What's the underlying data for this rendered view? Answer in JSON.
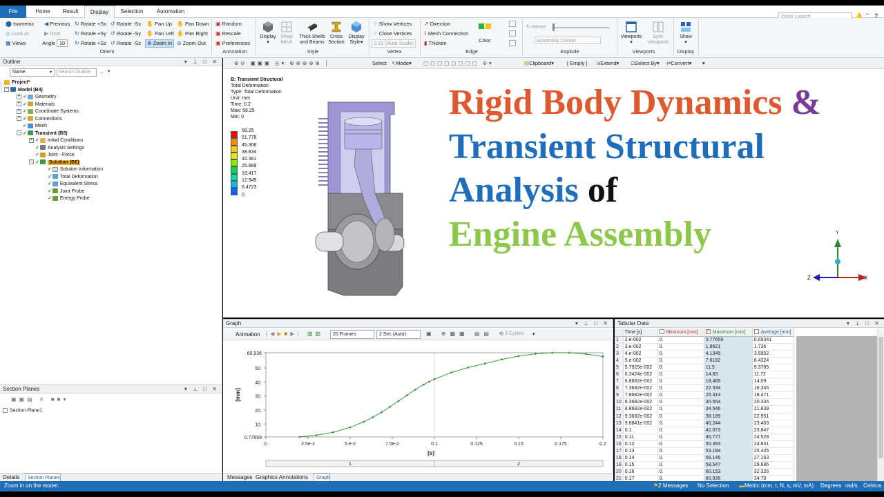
{
  "tabs": [
    "File",
    "Home",
    "Result",
    "Display",
    "Selection",
    "Automation"
  ],
  "quick_launch": "Quick Launch",
  "ribbon": {
    "orient": {
      "isometric": "Isometric",
      "previous": "Previous",
      "look_at": "Look At",
      "next": "Next",
      "views": "Views",
      "angle_label": "Angle",
      "angle_value": "10",
      "rotate_px": "Rotate +Sx",
      "rotate_nx": "Rotate -Sx",
      "rotate_py": "Rotate +Sy",
      "rotate_ny": "Rotate -Sy",
      "rotate_pz": "Rotate +Sz",
      "rotate_nz": "Rotate -Sz",
      "pan_up": "Pan Up",
      "pan_down": "Pan Down",
      "pan_left": "Pan Left",
      "pan_right": "Pan Right",
      "zoom_in": "Zoom In",
      "zoom_out": "Zoom Out",
      "group": "Orient"
    },
    "annotation": {
      "random": "Random",
      "rescale": "Rescale",
      "preferences": "Preferences",
      "group": "Annotation"
    },
    "style": {
      "display": "Display",
      "show_mesh": "Show Mesh",
      "thick_shells": "Thick Shells and Beams",
      "cross_section": "Cross Section",
      "display_style": "Display Style",
      "group": "Style"
    },
    "vertex": {
      "show_vertices": "Show Vertices",
      "close_vertices": "Close Vertices",
      "auto_scale": "0.31 (Auto Scale)",
      "group": "Vertex"
    },
    "edge": {
      "direction": "Direction",
      "mesh_connection": "Mesh Connection",
      "thicken": "Thicken",
      "color": "Color",
      "group": "Edge"
    },
    "explode": {
      "reset": "Reset",
      "assembly_center": "Assembly Center",
      "group": "Explode"
    },
    "viewports": {
      "viewports": "Viewports",
      "sync": "Sync Viewports",
      "group": "Viewports"
    },
    "display": {
      "show": "Show",
      "group": "Display"
    }
  },
  "outline": {
    "title": "Outline",
    "name_filter": "Name",
    "search_placeholder": "Search Outline",
    "items": [
      {
        "label": "Project*",
        "level": 0
      },
      {
        "label": "Model (B4)",
        "level": 1
      },
      {
        "label": "Geometry",
        "level": 2
      },
      {
        "label": "Materials",
        "level": 2
      },
      {
        "label": "Coordinate Systems",
        "level": 2
      },
      {
        "label": "Connections",
        "level": 2
      },
      {
        "label": "Mesh",
        "level": 2
      },
      {
        "label": "Transient (B5)",
        "level": 2
      },
      {
        "label": "Initial Conditions",
        "level": 3
      },
      {
        "label": "Analysis Settings",
        "level": 3
      },
      {
        "label": "Joint - Force",
        "level": 3
      },
      {
        "label": "Solution (B6)",
        "level": 3
      },
      {
        "label": "Solution Information",
        "level": 4
      },
      {
        "label": "Total Deformation",
        "level": 4
      },
      {
        "label": "Equivalent Stress",
        "level": 4
      },
      {
        "label": "Joint Probe",
        "level": 4
      },
      {
        "label": "Energy Probe",
        "level": 4
      }
    ]
  },
  "section_planes": {
    "title": "Section Planes",
    "item": "Section Plane1"
  },
  "left_tabs": [
    "Details",
    "Section Planes"
  ],
  "viewport_toolbar": {
    "select": "Select",
    "mode": "Mode",
    "clipboard": "Clipboard",
    "empty": "[ Empty ]",
    "extend": "Extend",
    "select_by": "Select By",
    "convert": "Convert"
  },
  "result_info": {
    "title": "B: Transient Structural",
    "lines": [
      "Total Deformation",
      "Type: Total Deformation",
      "Unit: mm",
      "Time: 0.2",
      "Max: 58.25",
      "Min: 0"
    ]
  },
  "legend": {
    "values": [
      "58.25",
      "51.778",
      "45.306",
      "38.834",
      "32.361",
      "25.889",
      "19.417",
      "12.945",
      "6.4723",
      "0"
    ],
    "colors": [
      "#ff0000",
      "#ff8800",
      "#ffcc00",
      "#ddee00",
      "#88ee00",
      "#00dd44",
      "#00ddaa",
      "#00bbee",
      "#0066ff",
      "#0000ff"
    ]
  },
  "headline": {
    "line1_a": "Rigid Body Dynamics",
    "line1_b": "&",
    "line2": "Transient Structural",
    "line3_a": "Analysis",
    "line3_b": "of",
    "line4": "Engine Assembly",
    "colors": {
      "orange": "#e0582e",
      "purple": "#7a3c9c",
      "blue": "#1f6ebd",
      "black": "#111111",
      "green": "#8ec84a"
    }
  },
  "triad": {
    "x": "X",
    "y": "Y",
    "z": "Z"
  },
  "graph": {
    "title": "Graph",
    "animation": "Animation",
    "frames": "20 Frames",
    "duration": "2 Sec (Auto)",
    "cycles": "3 Cycles",
    "steps": [
      "1",
      "2"
    ]
  },
  "chart_data": {
    "type": "line",
    "ylabel": "[mm]",
    "xlabel": "[s]",
    "x": [
      0.02,
      0.03,
      0.04,
      0.05,
      0.057925,
      0.063424,
      0.068682,
      0.073682,
      0.078682,
      0.083682,
      0.088682,
      0.093682,
      0.096841,
      0.1,
      0.11,
      0.12,
      0.13,
      0.14,
      0.15,
      0.16,
      0.17,
      0.18,
      0.19,
      0.2
    ],
    "values": [
      0.77659,
      1.9621,
      4.1349,
      7.6182,
      11.5,
      14.83,
      18.489,
      22.334,
      26.414,
      30.554,
      34.546,
      38.189,
      40.244,
      42.073,
      46.777,
      50.393,
      53.194,
      56.146,
      58.547,
      60.153,
      60.936,
      60.9,
      60.0,
      58.25
    ],
    "xlim": [
      0,
      0.2
    ],
    "ylim": [
      0.77659,
      60.936
    ],
    "yticks": [
      "60.936",
      "50.",
      "40.",
      "30.",
      "20.",
      "10.",
      "0.77659"
    ],
    "xticks": [
      "0.",
      "2.5e-2",
      "5.e-2",
      "7.5e-2",
      "0.1",
      "0.125",
      "0.15",
      "0.175",
      "0.2"
    ],
    "color": "#2a8a2a"
  },
  "tabular": {
    "title": "Tabular Data",
    "headers": [
      "",
      "Time [s]",
      "Minimum [mm]",
      "Maximum [mm]",
      "Average [mm]"
    ],
    "rows": [
      [
        "1",
        "2.e-002",
        "0.",
        "0.77659",
        "0.69341"
      ],
      [
        "2",
        "3.e-002",
        "0.",
        "1.9621",
        "1.736"
      ],
      [
        "3",
        "4.e-002",
        "0.",
        "4.1349",
        "3.5952"
      ],
      [
        "4",
        "5.e-002",
        "0.",
        "7.6182",
        "6.4324"
      ],
      [
        "5",
        "5.7925e-002",
        "0.",
        "11.5",
        "9.3785"
      ],
      [
        "6",
        "6.3424e-002",
        "0.",
        "14.83",
        "11.72"
      ],
      [
        "7",
        "6.8682e-002",
        "0.",
        "18.489",
        "14.09"
      ],
      [
        "8",
        "7.3682e-002",
        "0.",
        "22.334",
        "16.346"
      ],
      [
        "9",
        "7.8682e-002",
        "0.",
        "26.414",
        "18.471"
      ],
      [
        "10",
        "8.3682e-002",
        "0.",
        "30.554",
        "20.334"
      ],
      [
        "11",
        "8.8682e-002",
        "0.",
        "34.546",
        "21.839"
      ],
      [
        "12",
        "9.3682e-002",
        "0.",
        "38.189",
        "22.951"
      ],
      [
        "13",
        "9.6841e-002",
        "0.",
        "40.244",
        "23.463"
      ],
      [
        "14",
        "0.1",
        "0.",
        "42.073",
        "23.847"
      ],
      [
        "15",
        "0.11",
        "0.",
        "46.777",
        "24.528"
      ],
      [
        "16",
        "0.12",
        "0.",
        "50.393",
        "24.831"
      ],
      [
        "17",
        "0.13",
        "0.",
        "53.194",
        "25.435"
      ],
      [
        "18",
        "0.14",
        "0.",
        "56.146",
        "27.153"
      ],
      [
        "19",
        "0.15",
        "0.",
        "58.547",
        "29.686"
      ],
      [
        "20",
        "0.16",
        "0.",
        "60.153",
        "32.326"
      ],
      [
        "21",
        "0.17",
        "0.",
        "60.936",
        "34.79"
      ]
    ]
  },
  "graph_tabs": [
    "Messages",
    "Graphics Annotations",
    "Graph"
  ],
  "status": {
    "left": "Zoom in on the model.",
    "messages": "2 Messages",
    "selection": "No Selection",
    "units": "Metric (mm, t, N, s, mV, mA)",
    "angle": "Degrees",
    "rate": "rad/s",
    "temp": "Celsius"
  }
}
